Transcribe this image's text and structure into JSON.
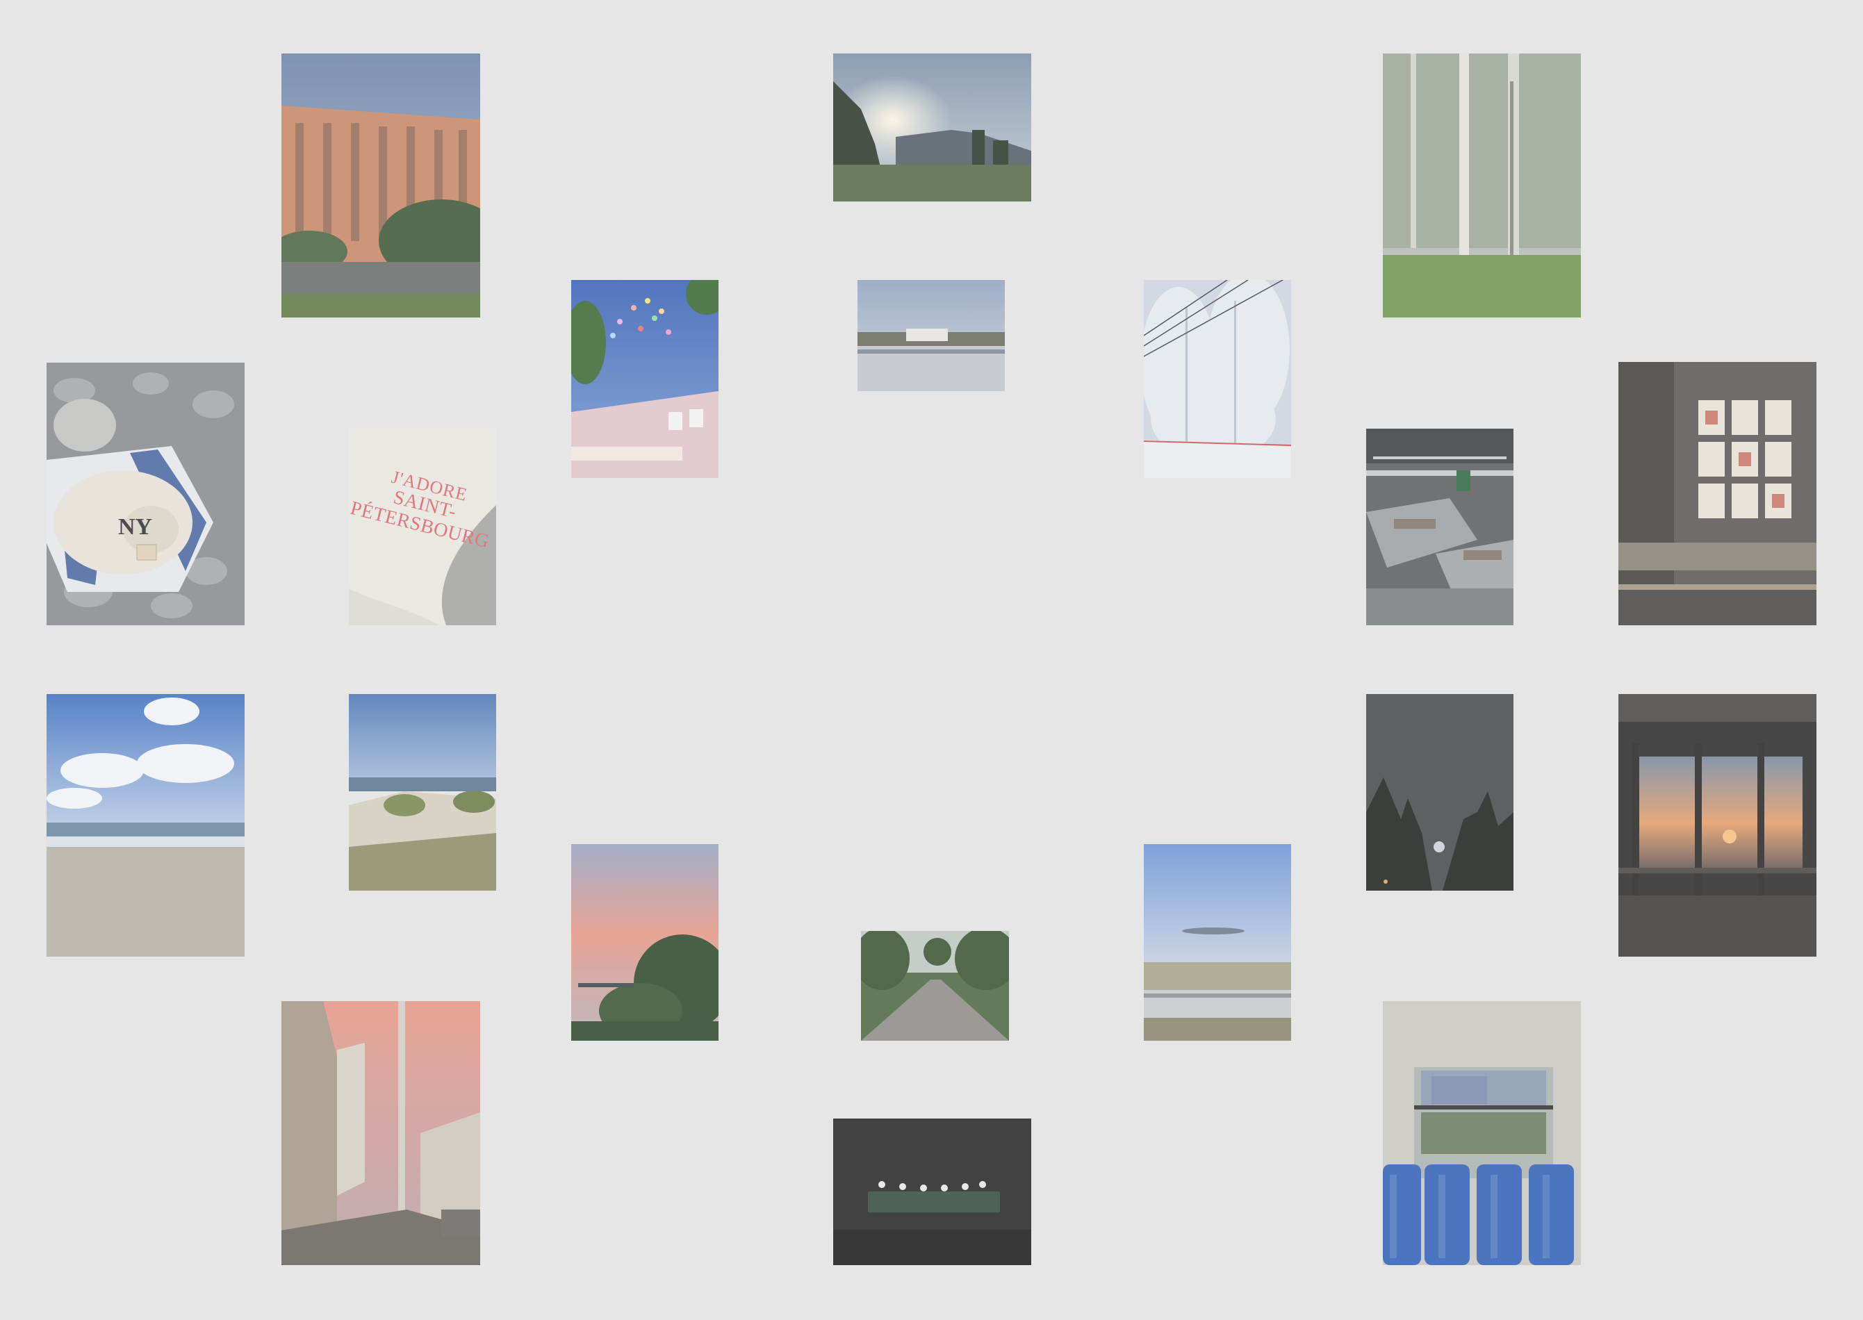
{
  "board": {
    "background": "#e6e6e6"
  },
  "photos": [
    {
      "name": "apartment-block-photo",
      "subject": "orange apartment building at dusk"
    },
    {
      "name": "mountain-sunrise-photo",
      "subject": "mountain valley with sun"
    },
    {
      "name": "birch-forest-photo",
      "subject": "foggy birch forest"
    },
    {
      "name": "balloons-sky-photo",
      "subject": "balloons over building"
    },
    {
      "name": "river-town-photo",
      "subject": "river with town"
    },
    {
      "name": "snowy-trees-photo",
      "subject": "snowy forest with wires"
    },
    {
      "name": "cap-on-pebbles-photo",
      "subject": "NY cap on pebbles"
    },
    {
      "name": "jadore-sweatshirt-photo",
      "subject": "embroidered sweatshirt",
      "text_line1": "J'ADORE",
      "text_line2": "SAINT-PÉTERSBOURG"
    },
    {
      "name": "bookstore-interior-photo",
      "subject": "bookstore interior"
    },
    {
      "name": "cafe-posters-photo",
      "subject": "cafe wall with posters"
    },
    {
      "name": "sunny-beach-photo",
      "subject": "sandy beach with clouds"
    },
    {
      "name": "dunes-sea-photo",
      "subject": "dunes and sea"
    },
    {
      "name": "night-trees-photo",
      "subject": "night sky over trees"
    },
    {
      "name": "station-sunset-photo",
      "subject": "sunset through station windows"
    },
    {
      "name": "pink-clouds-photo",
      "subject": "pink sunset clouds over trees"
    },
    {
      "name": "park-path-photo",
      "subject": "park path with trees"
    },
    {
      "name": "evening-field-photo",
      "subject": "field and guardrail at dusk"
    },
    {
      "name": "street-sunset-photo",
      "subject": "street with lamp post at sunset"
    },
    {
      "name": "concert-lights-photo",
      "subject": "concert stage lights"
    },
    {
      "name": "bus-window-photo",
      "subject": "bus interior with blue seats"
    }
  ]
}
